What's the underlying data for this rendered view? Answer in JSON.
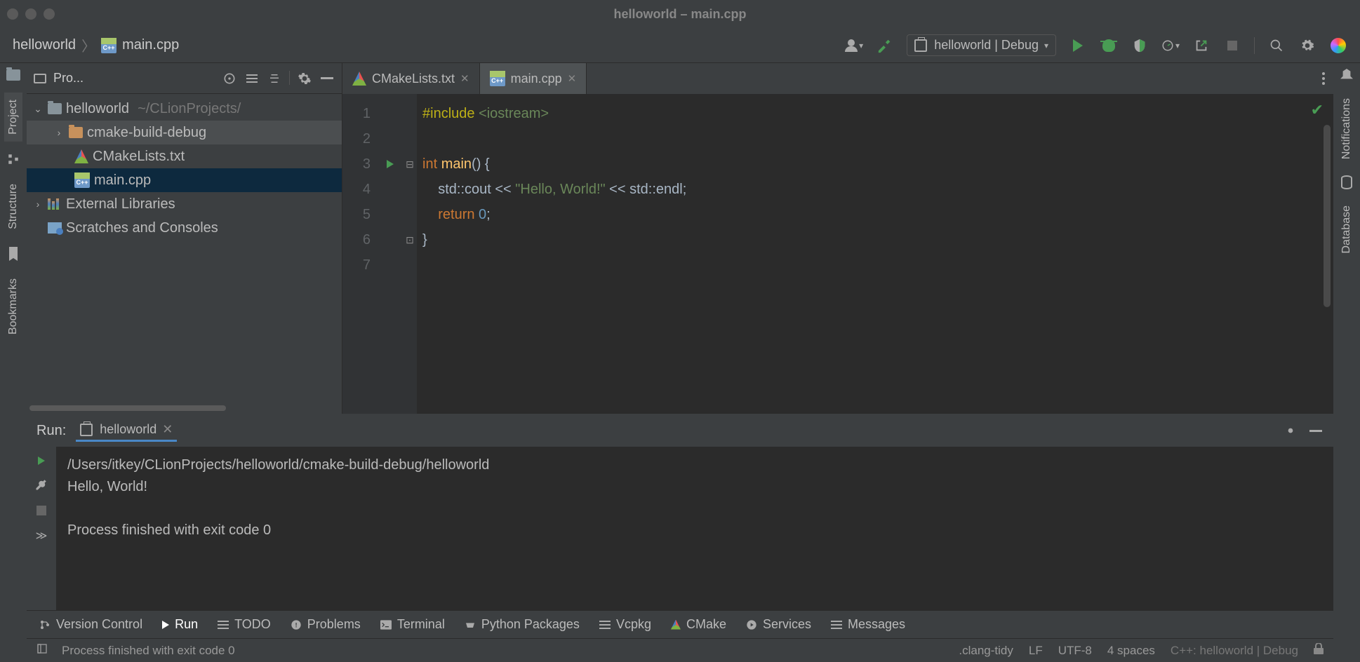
{
  "titlebar": {
    "title": "helloworld – main.cpp"
  },
  "breadcrumb": {
    "root": "helloworld",
    "file": "main.cpp"
  },
  "toolbar": {
    "run_config": "helloworld | Debug"
  },
  "project_panel": {
    "title": "Pro...",
    "tree": {
      "root": "helloworld",
      "root_path": "~/CLionProjects/",
      "cmake_build": "cmake-build-debug",
      "cmakelists": "CMakeLists.txt",
      "main": "main.cpp",
      "ext_libs": "External Libraries",
      "scratches": "Scratches and Consoles"
    }
  },
  "tabs": {
    "t1": "CMakeLists.txt",
    "t2": "main.cpp"
  },
  "code": {
    "lines": [
      "1",
      "2",
      "3",
      "4",
      "5",
      "6",
      "7"
    ],
    "l1_pp": "#include ",
    "l1_inc": "<iostream>",
    "l3_kw": "int ",
    "l3_fn": "main",
    "l3_rest": "() {",
    "l4_pre": "    std::cout << ",
    "l4_str": "\"Hello, World!\"",
    "l4_post": " << std::endl;",
    "l5_pre": "    ",
    "l5_kw": "return ",
    "l5_num": "0",
    "l5_post": ";",
    "l6": "}"
  },
  "run_panel": {
    "label": "Run:",
    "tab": "helloworld",
    "console_l1": "/Users/itkey/CLionProjects/helloworld/cmake-build-debug/helloworld",
    "console_l2": "Hello, World!",
    "console_l3": "",
    "console_l4": "Process finished with exit code 0"
  },
  "left_rail": {
    "project": "Project",
    "structure": "Structure",
    "bookmarks": "Bookmarks"
  },
  "right_rail": {
    "notifications": "Notifications",
    "database": "Database"
  },
  "bottom_bar": {
    "vcs": "Version Control",
    "run": "Run",
    "todo": "TODO",
    "problems": "Problems",
    "terminal": "Terminal",
    "python": "Python Packages",
    "vcpkg": "Vcpkg",
    "cmake": "CMake",
    "services": "Services",
    "messages": "Messages"
  },
  "status_bar": {
    "msg": "Process finished with exit code 0",
    "clang": ".clang-tidy",
    "le": "LF",
    "enc": "UTF-8",
    "indent": "4 spaces",
    "ctx": "C++: helloworld | Debug"
  }
}
